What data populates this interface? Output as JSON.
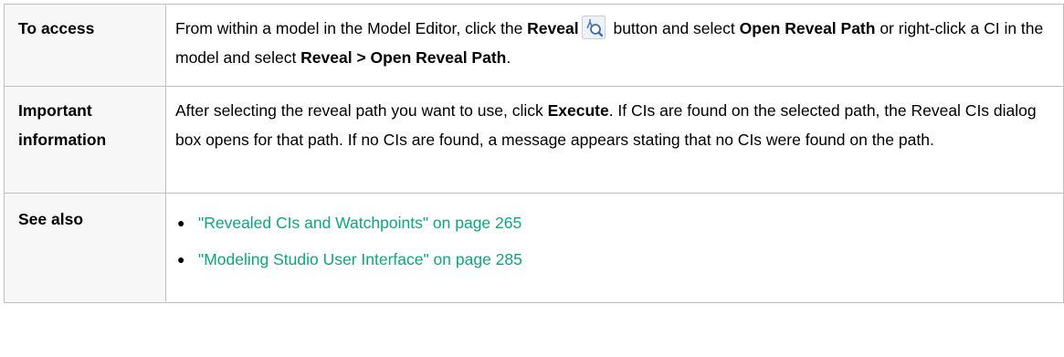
{
  "rows": {
    "access": {
      "label": "To access",
      "text1": "From within a model in the Model Editor, click the ",
      "bold1": "Reveal",
      "text2": " button and select ",
      "bold2": "Open Reveal Path",
      "text3": " or right-click a CI in the model and select ",
      "bold3": "Reveal > Open Reveal Path",
      "text4": ".",
      "icon": "reveal-icon"
    },
    "important": {
      "label": "Important information",
      "text1": "After selecting the reveal path you want to use, click ",
      "bold1": "Execute",
      "text2": ". If CIs are found on the selected path, the Reveal CIs dialog box opens for that path. If no CIs are found, a message appears stating that no CIs were found on the path."
    },
    "see_also": {
      "label": "See also",
      "links": [
        "\"Revealed CIs and Watchpoints\" on page 265",
        "\"Modeling Studio User Interface\" on page 285"
      ]
    }
  },
  "colors": {
    "link": "#0aa77f",
    "border": "#c0c0c0",
    "label_background": "#f7f7f7"
  }
}
